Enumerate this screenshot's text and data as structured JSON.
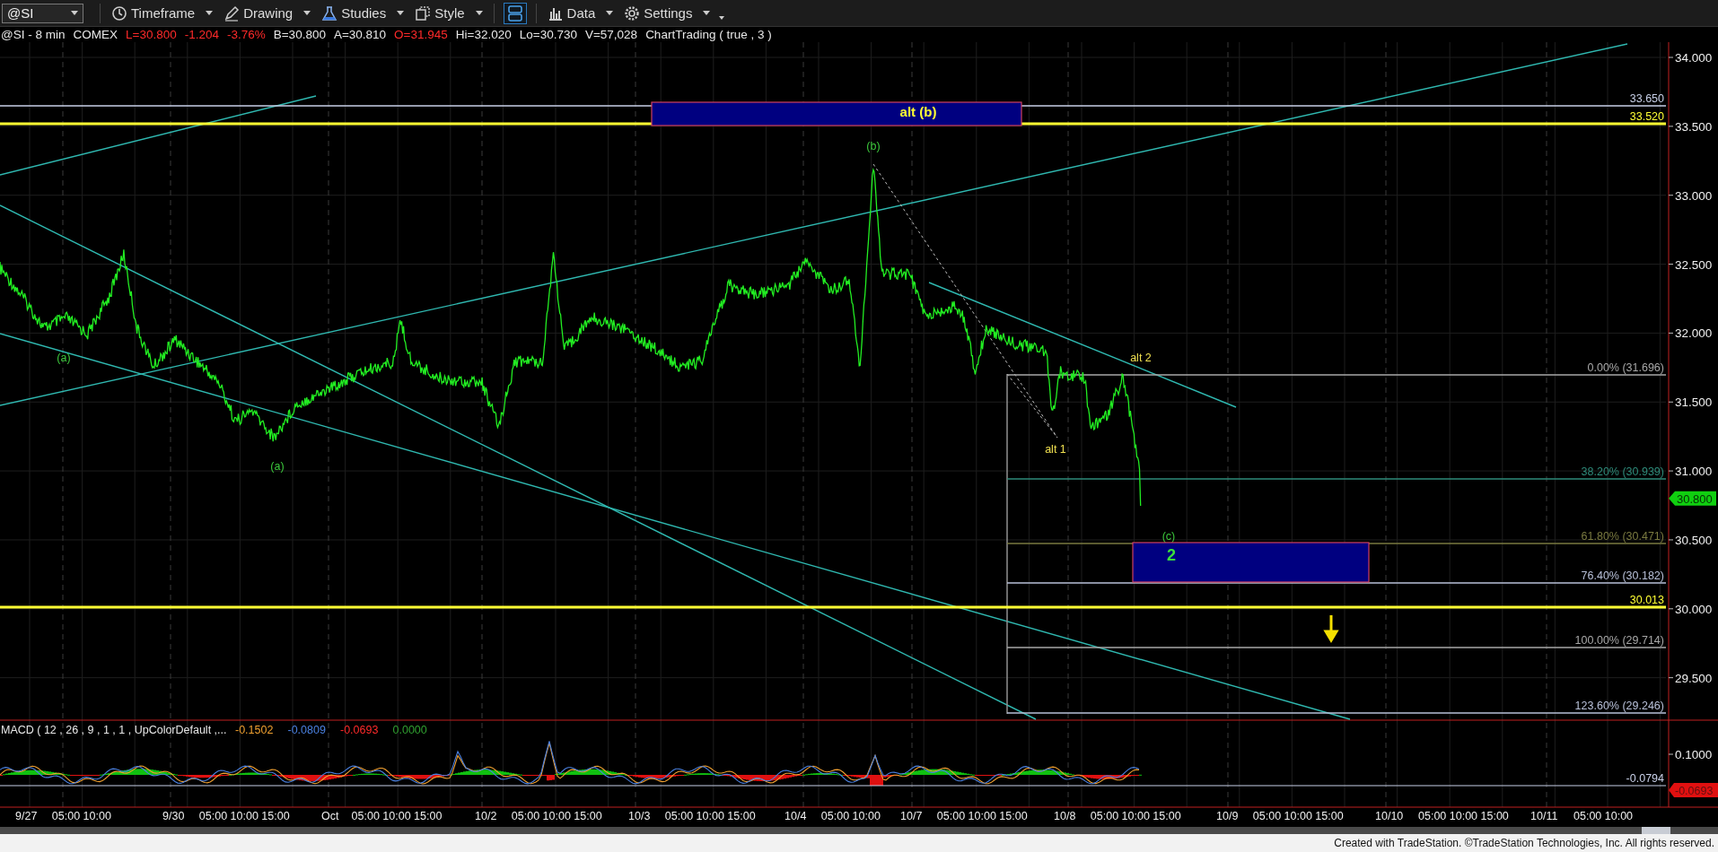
{
  "toolbar": {
    "symbol": "@SI",
    "menus": [
      {
        "label": "Timeframe"
      },
      {
        "label": "Drawing"
      },
      {
        "label": "Studies"
      },
      {
        "label": "Style"
      },
      {
        "label": "Data"
      },
      {
        "label": "Settings"
      }
    ]
  },
  "info_line": [
    {
      "text": "@SI - 8 min",
      "color": "#e8e8e8"
    },
    {
      "text": "COMEX",
      "color": "#e8e8e8"
    },
    {
      "text": "L=30.800",
      "color": "#ff2a2a"
    },
    {
      "text": "-1.204",
      "color": "#ff2a2a"
    },
    {
      "text": "-3.76%",
      "color": "#ff2a2a"
    },
    {
      "text": "B=30.800",
      "color": "#e8e8e8"
    },
    {
      "text": "A=30.810",
      "color": "#e8e8e8"
    },
    {
      "text": "O=31.945",
      "color": "#ff2a2a"
    },
    {
      "text": "Hi=32.020",
      "color": "#e8e8e8"
    },
    {
      "text": "Lo=30.730",
      "color": "#e8e8e8"
    },
    {
      "text": "V=57,028",
      "color": "#e8e8e8"
    },
    {
      "text": "ChartTrading ( true , 3 )",
      "color": "#e8e8e8"
    }
  ],
  "price_axis": {
    "ticks": [
      "34.000",
      "33.500",
      "33.000",
      "32.500",
      "32.000",
      "31.500",
      "31.000",
      "30.500",
      "30.000",
      "29.500"
    ],
    "last_price": "30.800"
  },
  "price_levels": [
    {
      "label": "33.650",
      "kind": "horizontal",
      "color": "#c8d0e8"
    },
    {
      "label": "33.520",
      "kind": "horizontal",
      "color": "#ffff33"
    },
    {
      "label": "0.00% (31.696)",
      "kind": "fibonacci",
      "color": "#a8a8a8"
    },
    {
      "label": "38.20% (30.939)",
      "kind": "fibonacci",
      "color": "#2e8b7a"
    },
    {
      "label": "61.80% (30.471)",
      "kind": "fibonacci",
      "color": "#7a7a40"
    },
    {
      "label": "76.40% (30.182)",
      "kind": "fibonacci",
      "color": "#b8c0d8"
    },
    {
      "label": "30.013",
      "kind": "horizontal",
      "color": "#ffff33"
    },
    {
      "label": "100.00% (29.714)",
      "kind": "fibonacci",
      "color": "#a8a8a8"
    },
    {
      "label": "123.60% (29.246)",
      "kind": "fibonacci",
      "color": "#b8c0d8"
    }
  ],
  "annotations": [
    {
      "text": "alt (b)",
      "kind": "boxed",
      "color": "#ffff33"
    },
    {
      "text": "(b)",
      "kind": "label",
      "color": "#3cc83c"
    },
    {
      "text": "(a)",
      "kind": "label",
      "color": "#3cc83c"
    },
    {
      "text": "(a)",
      "kind": "label",
      "color": "#3cc83c"
    },
    {
      "text": "alt 1",
      "kind": "label",
      "color": "#f0e050"
    },
    {
      "text": "alt 2",
      "kind": "label",
      "color": "#f0e050"
    },
    {
      "text": "(c)",
      "kind": "label",
      "color": "#3cc83c"
    },
    {
      "text": "2",
      "kind": "boxed",
      "color": "#3ce03c"
    }
  ],
  "macd": {
    "title": "MACD ( 12 , 26 , 9 , 1 , 1 , UpColorDefault ,...",
    "values": [
      {
        "text": "-0.1502",
        "color": "#f0a030"
      },
      {
        "text": "-0.0809",
        "color": "#4a80e0"
      },
      {
        "text": "-0.0693",
        "color": "#ff2a2a"
      },
      {
        "text": "0.0000",
        "color": "#30a030"
      }
    ],
    "axis_tick": "0.1000",
    "level_label": "-0.0794",
    "badge": "-0.0693"
  },
  "time_axis": [
    {
      "date": "9/27",
      "times": "05:00 10:00"
    },
    {
      "date": "9/30",
      "times": "05:00 10:00 15:00"
    },
    {
      "date": "Oct",
      "times": "05:00 10:00 15:00"
    },
    {
      "date": "10/2",
      "times": "05:00 10:00 15:00"
    },
    {
      "date": "10/3",
      "times": "05:00 10:00 15:00"
    },
    {
      "date": "10/4",
      "times": "05:00 10:00"
    },
    {
      "date": "10/7",
      "times": "05:00 10:00 15:00"
    },
    {
      "date": "10/8",
      "times": "05:00 10:00 15:00"
    },
    {
      "date": "10/9",
      "times": "05:00 10:00 15:00"
    },
    {
      "date": "10/10",
      "times": "05:00 10:00 15:00"
    },
    {
      "date": "10/11",
      "times": "05:00 10:00"
    }
  ],
  "footer": "Created with TradeStation. ©TradeStation Technologies, Inc. All rights reserved."
}
